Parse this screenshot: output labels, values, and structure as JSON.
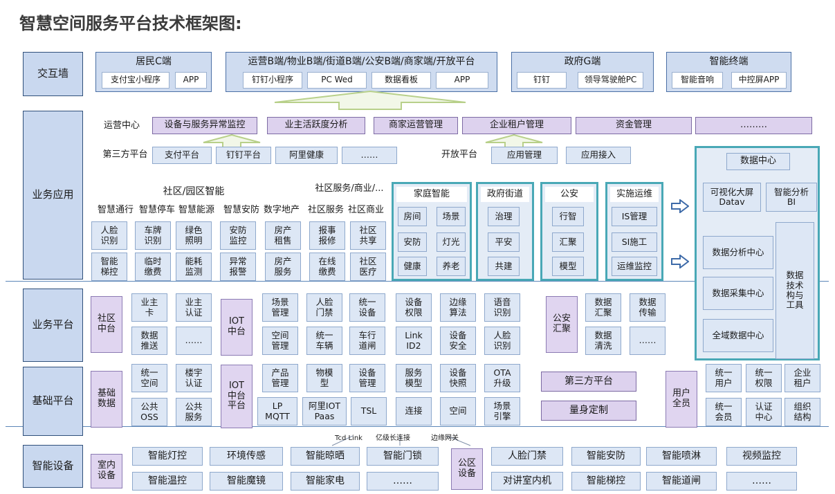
{
  "title": "智慧空间服务平台技术框架图:",
  "layers": {
    "interaction": "交互墙",
    "business_app": "业务应用",
    "business_platform": "业务平台",
    "base_platform": "基础平台",
    "devices": "智能设备"
  },
  "interaction": {
    "resident": {
      "title": "居民C端",
      "items": [
        "支付宝小程序",
        "APP"
      ]
    },
    "ops": {
      "title": "运营B端/物业B端/街道B端/公安B端/商家端/开放平台",
      "items": [
        "钉钉小程序",
        "PC  Wed",
        "数据看板",
        "APP"
      ]
    },
    "gov": {
      "title": "政府G端",
      "items": [
        "钉钉",
        "领导驾驶舱PC"
      ]
    },
    "terminal": {
      "title": "智能终端",
      "items": [
        "智能音响",
        "中控屏APP"
      ]
    }
  },
  "ops_center": {
    "label": "运营中心",
    "items": [
      "设备与服务异常监控",
      "业主活跃度分析",
      "商家运营管理",
      "企业租户管理",
      "资金管理",
      "………"
    ]
  },
  "third_party": {
    "label": "第三方平台",
    "items": [
      "支付平台",
      "钉钉平台",
      "阿里健康",
      "……"
    ]
  },
  "open_platform": {
    "label": "开放平台",
    "items": [
      "应用管理",
      "应用接入"
    ]
  },
  "community": {
    "title": "社区/园区智能",
    "service_title": "社区服务/商业/...",
    "headers": [
      "智慧通行",
      "智慧停车",
      "智慧能源",
      "智慧安防",
      "数字地产",
      "社区服务",
      "社区商业"
    ],
    "cells": [
      "人脸\n识别",
      "车牌\n识别",
      "绿色\n照明",
      "安防\n监控",
      "房产\n租售",
      "报事\n报修",
      "社区\n共享",
      "智能\n梯控",
      "临时\n缴费",
      "能耗\n监测",
      "异常\n报警",
      "房产\n服务",
      "在线\n缴费",
      "社区\n医疗"
    ]
  },
  "home": {
    "title": "家庭智能",
    "items": [
      "房间",
      "场景",
      "安防",
      "灯光",
      "健康",
      "养老"
    ]
  },
  "gov_street": {
    "title": "政府街道",
    "items": [
      "治理",
      "平安",
      "共建"
    ]
  },
  "police": {
    "title": "公安",
    "items": [
      "行智",
      "汇聚",
      "模型"
    ]
  },
  "ops_maint": {
    "title": "实施运维",
    "items": [
      "IS管理",
      "SI施工",
      "运维监控"
    ]
  },
  "data_center": {
    "title": "数据中心",
    "visual": "可视化大屏\nDatav",
    "bi": "智能分析\nBI",
    "analysis": "数据分析中心",
    "collect": "数据采集中心",
    "global": "全域数据中心",
    "tools": "数据\n技术\n构与\n工具"
  },
  "biz_platform": {
    "community_center": "社区\n中台",
    "left": [
      "业主\n卡",
      "业主\n认证",
      "数据\n推送",
      "……"
    ],
    "iot_center": "IOT\n中台",
    "iot_top": [
      "场景\n管理",
      "人脸\n门禁",
      "统一\n设备",
      "设备\n权限",
      "边缘\n算法",
      "语音\n识别"
    ],
    "iot_bottom": [
      "空间\n管理",
      "统一\n车辆",
      "车行\n道闸",
      "Link\nID2",
      "设备\n安全",
      "人脸\n识别"
    ],
    "police_center": "公安\n汇聚",
    "police_items": [
      "数据\n汇聚",
      "数据\n传输",
      "数据\n清洗",
      "……"
    ]
  },
  "base_platform": {
    "base_data": "基础\n数据",
    "left": [
      "统一\n空间",
      "楼宇\n认证",
      "公共\nOSS",
      "公共\n服务"
    ],
    "iot_platform": "IOT\n中台\n平台",
    "top": [
      "产品\n管理",
      "物模\n型",
      "设备\n管理",
      "服务\n模型",
      "设备\n快照",
      "OTA\n升级"
    ],
    "bottom": [
      "LP\nMQTT",
      "阿里IOT\nPaas",
      "TSL",
      "连接",
      "空间",
      "场景\n引擎"
    ],
    "third_party": "第三方平台",
    "custom": "量身定制",
    "all_users": "用户\n全员",
    "right": [
      "统一\n用户",
      "统一\n权限",
      "企业\n租户",
      "统一\n会员",
      "认证\n中心",
      "组织\n结构"
    ]
  },
  "connectors": [
    "Tcd Link",
    "亿级长连接",
    "边缘网关"
  ],
  "devices": {
    "indoor": "室内\n设备",
    "indoor_items": [
      "智能灯控",
      "环境传感",
      "智能晾晒",
      "智能门锁",
      "智能温控",
      "智能魔镜",
      "智能家电",
      "……"
    ],
    "community": "公区\n设备",
    "community_items": [
      "人脸门禁",
      "智能安防",
      "智能喷淋",
      "视频监控",
      "对讲室内机",
      "智能梯控",
      "智能道闸",
      "……"
    ]
  },
  "colors": {
    "layer": "#c9d8ef",
    "cell": "#dde7f5",
    "purple": "#ddd2ee",
    "teal": "#49a8b6",
    "border": "#2f4f7a"
  }
}
